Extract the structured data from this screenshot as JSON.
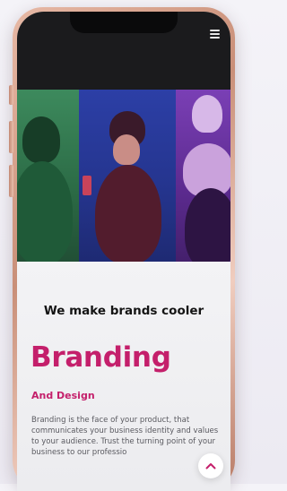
{
  "header": {
    "menu_icon": "hamburger-menu-icon"
  },
  "hero": {
    "panel_colors": [
      "#3d8a5d",
      "#2c3fa6",
      "#7a3fb5"
    ]
  },
  "main": {
    "tagline": "We make brands cooler",
    "heading": "Branding",
    "subheading": "And Design",
    "paragraph": "Branding is the face of your product, that communicates your business identity and values to your audience. Trust the turning point of your business to our professio"
  },
  "scroll_top": {
    "icon": "chevron-up-icon"
  },
  "colors": {
    "accent": "#c41f6b",
    "phone_frame": "#d9a48f"
  }
}
